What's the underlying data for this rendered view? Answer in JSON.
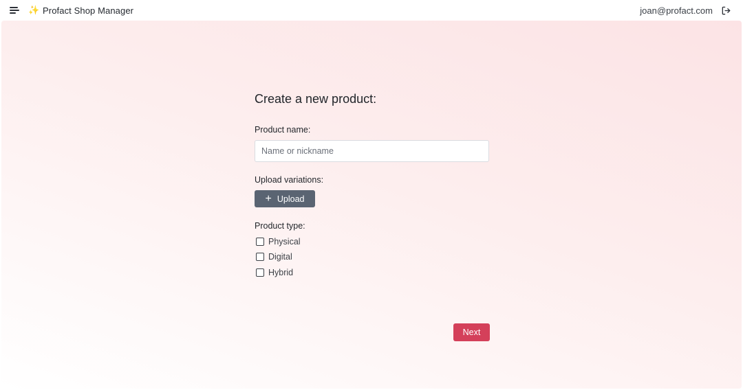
{
  "header": {
    "menu_icon": "hamburger-menu-icon",
    "logo_icon": "sparkle-icon",
    "logo_glyph": "✨",
    "app_title": "Profact Shop Manager",
    "user_email": "joan@profact.com",
    "logout_icon": "logout-icon"
  },
  "form": {
    "title": "Create a new product:",
    "product_name_label": "Product name:",
    "product_name_value": "",
    "product_name_placeholder": "Name or nickname",
    "upload_label": "Upload variations:",
    "upload_button_icon": "plus-icon",
    "upload_button_glyph": "+",
    "upload_button_label": "Upload",
    "product_type_label": "Product type:",
    "product_types": [
      {
        "label": "Physical",
        "checked": false
      },
      {
        "label": "Digital",
        "checked": false
      },
      {
        "label": "Hybrid",
        "checked": false
      }
    ],
    "next_button_label": "Next"
  },
  "colors": {
    "primary_button": "#d4405a",
    "secondary_button": "#5a6472",
    "background_tint": "#fce3e5"
  }
}
